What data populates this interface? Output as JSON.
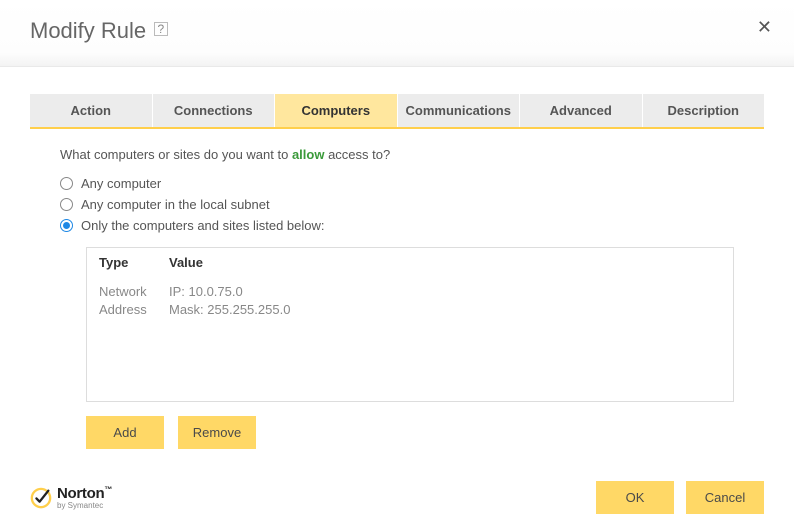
{
  "header": {
    "title": "Modify Rule",
    "help_symbol": "?"
  },
  "tabs": [
    {
      "label": "Action",
      "active": false
    },
    {
      "label": "Connections",
      "active": false
    },
    {
      "label": "Computers",
      "active": true
    },
    {
      "label": "Communications",
      "active": false
    },
    {
      "label": "Advanced",
      "active": false
    },
    {
      "label": "Description",
      "active": false
    }
  ],
  "content": {
    "prompt_pre": "What computers or sites do you want to ",
    "prompt_allow": "allow",
    "prompt_post": " access to?",
    "options": [
      {
        "label": "Any computer",
        "checked": false
      },
      {
        "label": "Any computer in the local subnet",
        "checked": false
      },
      {
        "label": "Only the computers and sites listed below:",
        "checked": true
      }
    ],
    "list": {
      "col_type": "Type",
      "col_value": "Value",
      "rows": [
        {
          "type_line1": "Network",
          "type_line2": "Address",
          "value_line1": "IP: 10.0.75.0",
          "value_line2": "Mask: 255.255.255.0"
        }
      ]
    },
    "add_label": "Add",
    "remove_label": "Remove"
  },
  "footer": {
    "brand": "Norton",
    "by": "by Symantec",
    "ok": "OK",
    "cancel": "Cancel"
  }
}
